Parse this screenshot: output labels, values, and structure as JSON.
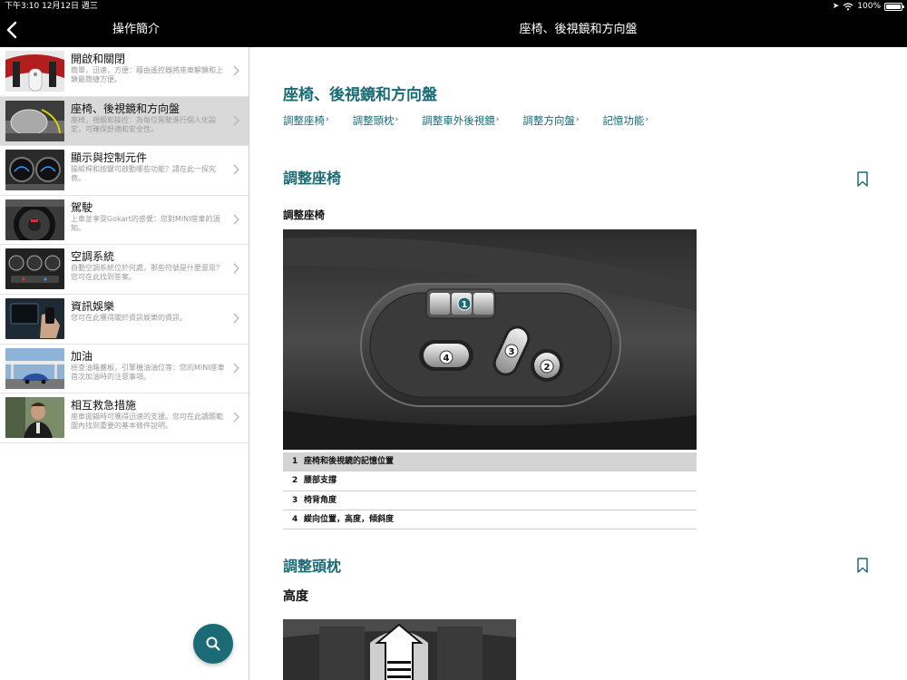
{
  "status": {
    "time_date": "下午3:10   12月12日 週三",
    "battery": "100%"
  },
  "nav": {
    "left_title": "操作簡介",
    "center_title": "座椅、後視鏡和方向盤"
  },
  "sidebar": {
    "items": [
      {
        "title": "開啟和關閉",
        "desc": "簡單，迅速，方便：藉由遙控器將座車解鎖和上鎖最簡捷方便。",
        "selected": false
      },
      {
        "title": "座椅、後視鏡和方向盤",
        "desc": "座椅，視鏡和操控：為每位駕駛進行個人化設定，可確保舒適和安全性。",
        "selected": true
      },
      {
        "title": "顯示與控制元件",
        "desc": "操縱桿和按鍵可啟動哪些功能？請在此一探究竟。",
        "selected": false
      },
      {
        "title": "駕駛",
        "desc": "上車並享受Gokart的感覺：您對MINI座車的須知。",
        "selected": false
      },
      {
        "title": "空調系統",
        "desc": "自動空調系統位於何處，那些符號是什麼意思？您可在此找到答案。",
        "selected": false
      },
      {
        "title": "資訊娛樂",
        "desc": "您可在此獲得關於資訊娛樂的資訊。",
        "selected": false
      },
      {
        "title": "加油",
        "desc": "檢查油箱蓋板，引擎機油油位等：您的MINI座車首次加油時的注意事項。",
        "selected": false
      },
      {
        "title": "相互救急措施",
        "desc": "座車拋錨時可獲得迅速的支援。您可在此讀題範圍內找到重要的基本條件說明。",
        "selected": false
      }
    ]
  },
  "main": {
    "page_title": "座椅、後視鏡和方向盤",
    "quicklinks": [
      "調整座椅",
      "調整頭枕",
      "調整車外後視鏡",
      "調整方向盤",
      "記憶功能"
    ],
    "section1": {
      "title": "調整座椅",
      "subheading": "調整座椅",
      "legend": [
        {
          "num": "1",
          "text": "座椅和後視鏡的記憶位置"
        },
        {
          "num": "2",
          "text": "腰部支撐"
        },
        {
          "num": "3",
          "text": "椅背角度"
        },
        {
          "num": "4",
          "text": "縱向位置，高度，傾斜度"
        }
      ]
    },
    "section2": {
      "title": "調整頭枕",
      "subheading": "高度"
    }
  },
  "colors": {
    "accent": "#1a6b75",
    "selected_bg": "#d9d9d9"
  }
}
